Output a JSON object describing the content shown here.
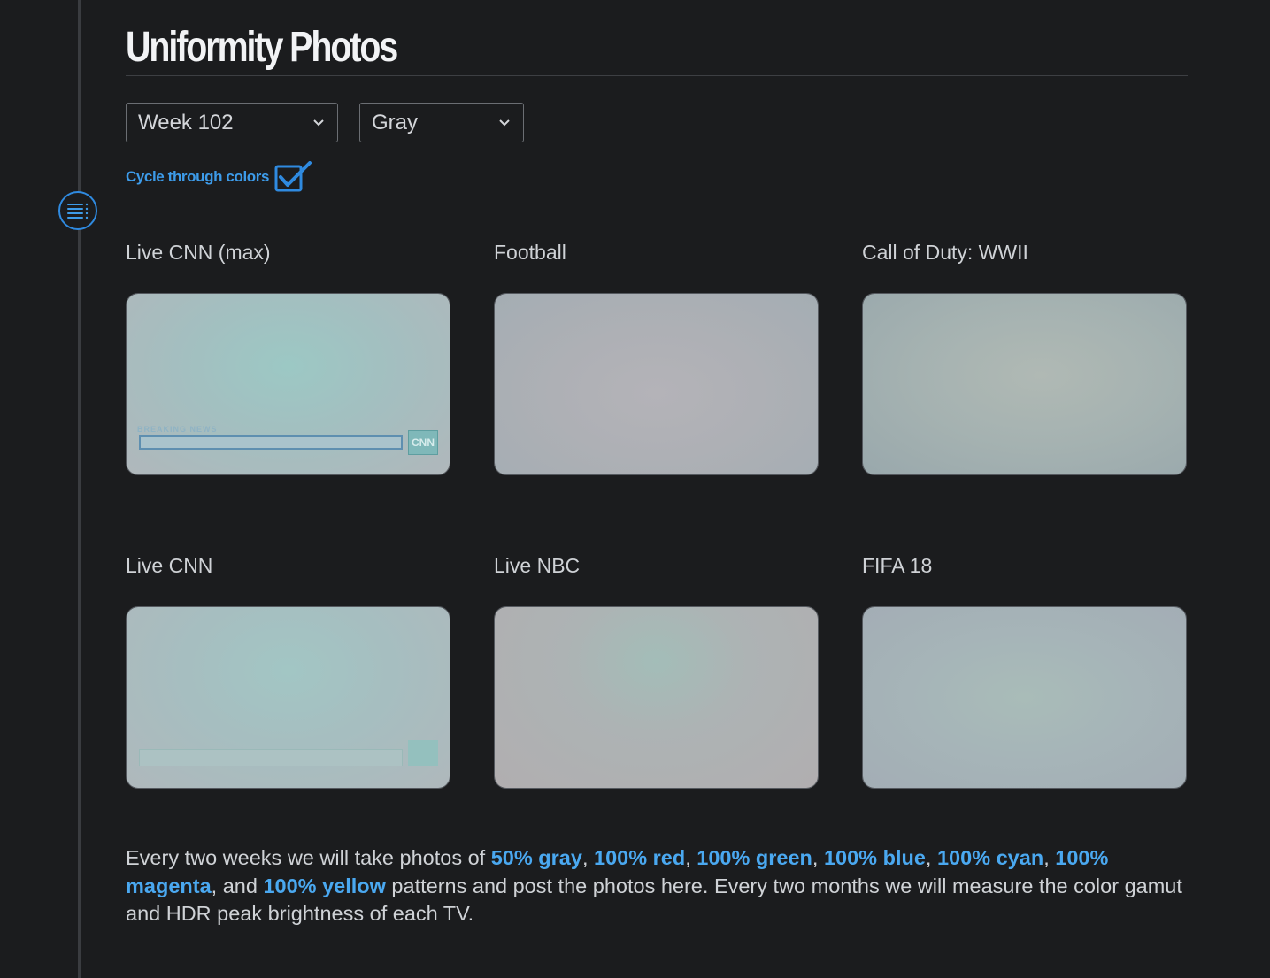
{
  "page": {
    "title": "Uniformity Photos"
  },
  "filters": {
    "week": "Week 102",
    "color": "Gray",
    "cycle_label": "Cycle through colors",
    "cycle_checked": true
  },
  "photos": [
    {
      "label": "Live CNN (max)"
    },
    {
      "label": "Football"
    },
    {
      "label": "Call of Duty: WWII"
    },
    {
      "label": "Live CNN"
    },
    {
      "label": "Live NBC"
    },
    {
      "label": "FIFA 18"
    }
  ],
  "overlay_text": {
    "breaking": "BREAKING NEWS",
    "cnn": "CNN"
  },
  "description": {
    "intro": "Every two weeks we will take photos of ",
    "links": [
      "50% gray",
      "100% red",
      "100% green",
      "100% blue",
      "100% cyan",
      "100% magenta",
      "100% yellow"
    ],
    "sep_comma": ", ",
    "sep_and": ", and ",
    "outro": " patterns and post the photos here. Every two months we will measure the color gamut and HDR peak brightness of each TV."
  },
  "colors": {
    "background": "#1b1c1e",
    "accent": "#3d9be9",
    "link": "#4aa8f0",
    "rail": "#3a3c40"
  },
  "icons": {
    "toc": "list-icon",
    "dropdown": "chevron-down-icon",
    "check": "checkmark-icon"
  }
}
